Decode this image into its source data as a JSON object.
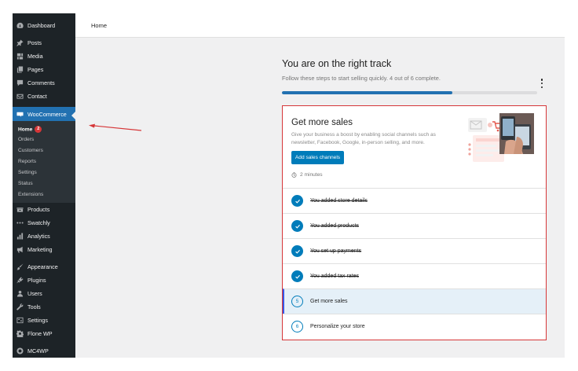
{
  "sidebar": {
    "top_items": [
      {
        "label": "Dashboard",
        "icon": "dashboard-icon"
      },
      {
        "label": "Posts",
        "icon": "pin-icon"
      },
      {
        "label": "Media",
        "icon": "media-icon"
      },
      {
        "label": "Pages",
        "icon": "pages-icon"
      },
      {
        "label": "Comments",
        "icon": "comment-icon"
      },
      {
        "label": "Contact",
        "icon": "mail-icon"
      }
    ],
    "woocommerce": {
      "label": "WooCommerce",
      "icon": "woo-icon"
    },
    "submenu": [
      {
        "label": "Home",
        "badge": "2"
      },
      {
        "label": "Orders"
      },
      {
        "label": "Customers"
      },
      {
        "label": "Reports"
      },
      {
        "label": "Settings"
      },
      {
        "label": "Status"
      },
      {
        "label": "Extensions"
      }
    ],
    "bottom_items": [
      {
        "label": "Products",
        "icon": "products-icon"
      },
      {
        "label": "Swatchly",
        "icon": "dots-icon"
      },
      {
        "label": "Analytics",
        "icon": "bar-chart-icon"
      },
      {
        "label": "Marketing",
        "icon": "megaphone-icon"
      },
      {
        "label": "Appearance",
        "icon": "brush-icon"
      },
      {
        "label": "Plugins",
        "icon": "plug-icon"
      },
      {
        "label": "Users",
        "icon": "user-icon"
      },
      {
        "label": "Tools",
        "icon": "wrench-icon"
      },
      {
        "label": "Settings",
        "icon": "settings-icon"
      },
      {
        "label": "Flone WP",
        "icon": "gear-icon"
      },
      {
        "label": "MC4WP",
        "icon": "mc4wp-icon"
      }
    ]
  },
  "header": {
    "title": "Home"
  },
  "progress": {
    "title": "You are on the right track",
    "subtitle": "Follow these steps to start selling quickly. 4 out of 6 complete.",
    "completed": 4,
    "total": 6
  },
  "card": {
    "heading": "Get more sales",
    "description": "Give your business a boost by enabling social channels such as newsletter, Facebook, Google, in-person selling, and more.",
    "button_label": "Add sales channels",
    "time": "2 minutes"
  },
  "tasks": [
    {
      "label": "You added store details",
      "status": "done"
    },
    {
      "label": "You added products",
      "status": "done"
    },
    {
      "label": "You set up payments",
      "status": "done"
    },
    {
      "label": "You added tax rates",
      "status": "done"
    },
    {
      "label": "Get more sales",
      "status": "current",
      "number": "5"
    },
    {
      "label": "Personalize your store",
      "status": "pending",
      "number": "6"
    }
  ],
  "colors": {
    "sidebar_bg": "#1d2327",
    "submenu_bg": "#2c3338",
    "accent": "#2271b1",
    "button": "#007cba",
    "highlight_border": "#d63638",
    "badge": "#d63638"
  }
}
